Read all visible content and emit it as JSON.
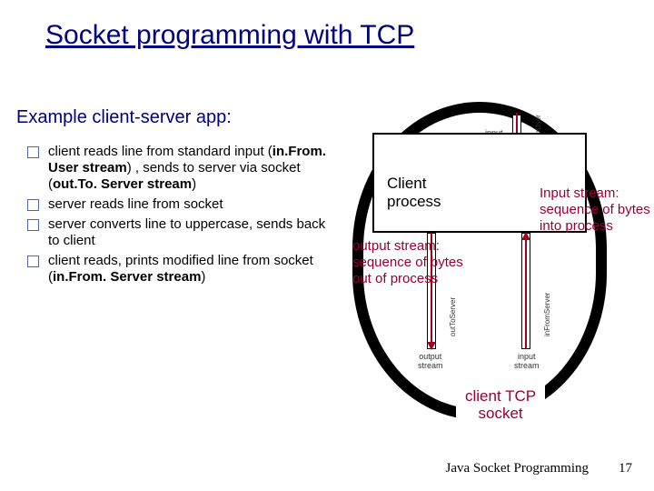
{
  "title": "Socket programming with TCP",
  "subtitle": "Example client-server app:",
  "bullets": [
    "client reads line from standard input (<b>in.From. User stream</b>) , sends to server via socket (<b>out.To. Server stream</b>)",
    "server reads line from socket",
    "server converts line to uppercase, sends back to client",
    "client reads, prints  modified line from socket (<b>in.From. Server stream</b>)"
  ],
  "diagram": {
    "process_label": "Client\nprocess",
    "socket_label": "client TCP\nsocket",
    "output_caption": "output stream:\nsequence of bytes\nout of process",
    "input_caption": "Input stream:\nsequence of bytes\ninto process",
    "top_stream_label": "input\nstream",
    "top_right_vert": "inFromUser",
    "bottom_left_label": "output\nstream",
    "bottom_left_vert": "outToServer",
    "bottom_right_label": "input\nstream",
    "bottom_right_vert": "inFromServer"
  },
  "footer": {
    "text": "Java Socket Programming",
    "page": "17"
  }
}
